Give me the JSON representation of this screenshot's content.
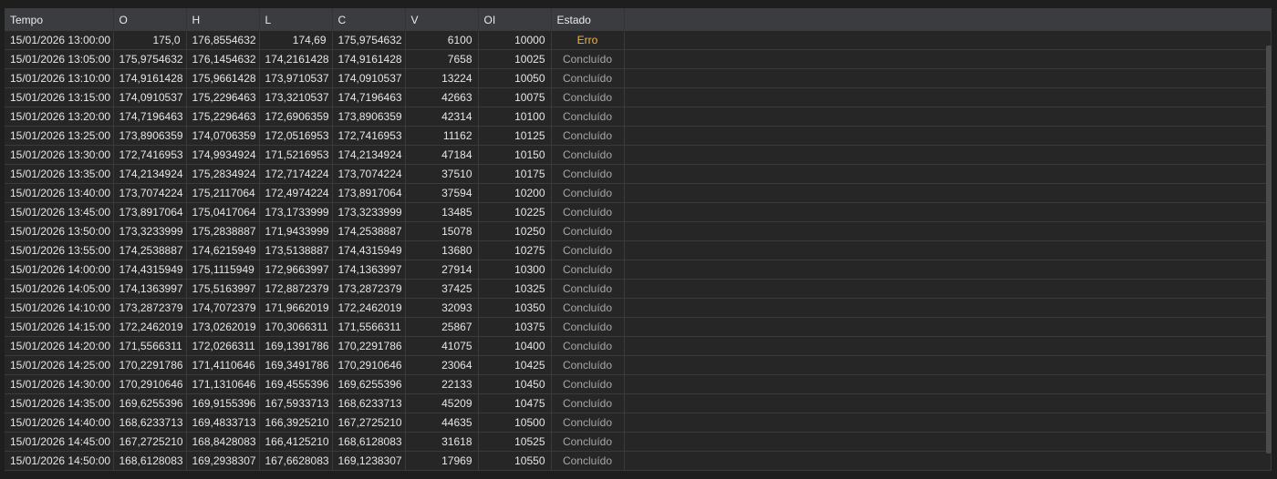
{
  "columns": [
    "Tempo",
    "O",
    "H",
    "L",
    "C",
    "V",
    "OI",
    "Estado"
  ],
  "colors": {
    "error": "#f3b53f",
    "status": "#a7a7a7"
  },
  "rows": [
    {
      "tempo": "15/01/2026 13:00:00",
      "o": "175,0",
      "h": "176,8554632",
      "l": "174,69",
      "c": "175,9754632",
      "v": "6100",
      "oi": "10000",
      "estado": "Erro"
    },
    {
      "tempo": "15/01/2026 13:05:00",
      "o": "175,9754632",
      "h": "176,1454632",
      "l": "174,2161428",
      "c": "174,9161428",
      "v": "7658",
      "oi": "10025",
      "estado": "Concluído"
    },
    {
      "tempo": "15/01/2026 13:10:00",
      "o": "174,9161428",
      "h": "175,9661428",
      "l": "173,9710537",
      "c": "174,0910537",
      "v": "13224",
      "oi": "10050",
      "estado": "Concluído"
    },
    {
      "tempo": "15/01/2026 13:15:00",
      "o": "174,0910537",
      "h": "175,2296463",
      "l": "173,3210537",
      "c": "174,7196463",
      "v": "42663",
      "oi": "10075",
      "estado": "Concluído"
    },
    {
      "tempo": "15/01/2026 13:20:00",
      "o": "174,7196463",
      "h": "175,2296463",
      "l": "172,6906359",
      "c": "173,8906359",
      "v": "42314",
      "oi": "10100",
      "estado": "Concluído"
    },
    {
      "tempo": "15/01/2026 13:25:00",
      "o": "173,8906359",
      "h": "174,0706359",
      "l": "172,0516953",
      "c": "172,7416953",
      "v": "11162",
      "oi": "10125",
      "estado": "Concluído"
    },
    {
      "tempo": "15/01/2026 13:30:00",
      "o": "172,7416953",
      "h": "174,9934924",
      "l": "171,5216953",
      "c": "174,2134924",
      "v": "47184",
      "oi": "10150",
      "estado": "Concluído"
    },
    {
      "tempo": "15/01/2026 13:35:00",
      "o": "174,2134924",
      "h": "175,2834924",
      "l": "172,7174224",
      "c": "173,7074224",
      "v": "37510",
      "oi": "10175",
      "estado": "Concluído"
    },
    {
      "tempo": "15/01/2026 13:40:00",
      "o": "173,7074224",
      "h": "175,2117064",
      "l": "172,4974224",
      "c": "173,8917064",
      "v": "37594",
      "oi": "10200",
      "estado": "Concluído"
    },
    {
      "tempo": "15/01/2026 13:45:00",
      "o": "173,8917064",
      "h": "175,0417064",
      "l": "173,1733999",
      "c": "173,3233999",
      "v": "13485",
      "oi": "10225",
      "estado": "Concluído"
    },
    {
      "tempo": "15/01/2026 13:50:00",
      "o": "173,3233999",
      "h": "175,2838887",
      "l": "171,9433999",
      "c": "174,2538887",
      "v": "15078",
      "oi": "10250",
      "estado": "Concluído"
    },
    {
      "tempo": "15/01/2026 13:55:00",
      "o": "174,2538887",
      "h": "174,6215949",
      "l": "173,5138887",
      "c": "174,4315949",
      "v": "13680",
      "oi": "10275",
      "estado": "Concluído"
    },
    {
      "tempo": "15/01/2026 14:00:00",
      "o": "174,4315949",
      "h": "175,1115949",
      "l": "172,9663997",
      "c": "174,1363997",
      "v": "27914",
      "oi": "10300",
      "estado": "Concluído"
    },
    {
      "tempo": "15/01/2026 14:05:00",
      "o": "174,1363997",
      "h": "175,5163997",
      "l": "172,8872379",
      "c": "173,2872379",
      "v": "37425",
      "oi": "10325",
      "estado": "Concluído"
    },
    {
      "tempo": "15/01/2026 14:10:00",
      "o": "173,2872379",
      "h": "174,7072379",
      "l": "171,9662019",
      "c": "172,2462019",
      "v": "32093",
      "oi": "10350",
      "estado": "Concluído"
    },
    {
      "tempo": "15/01/2026 14:15:00",
      "o": "172,2462019",
      "h": "173,0262019",
      "l": "170,3066311",
      "c": "171,5566311",
      "v": "25867",
      "oi": "10375",
      "estado": "Concluído"
    },
    {
      "tempo": "15/01/2026 14:20:00",
      "o": "171,5566311",
      "h": "172,0266311",
      "l": "169,1391786",
      "c": "170,2291786",
      "v": "41075",
      "oi": "10400",
      "estado": "Concluído"
    },
    {
      "tempo": "15/01/2026 14:25:00",
      "o": "170,2291786",
      "h": "171,4110646",
      "l": "169,3491786",
      "c": "170,2910646",
      "v": "23064",
      "oi": "10425",
      "estado": "Concluído"
    },
    {
      "tempo": "15/01/2026 14:30:00",
      "o": "170,2910646",
      "h": "171,1310646",
      "l": "169,4555396",
      "c": "169,6255396",
      "v": "22133",
      "oi": "10450",
      "estado": "Concluído"
    },
    {
      "tempo": "15/01/2026 14:35:00",
      "o": "169,6255396",
      "h": "169,9155396",
      "l": "167,5933713",
      "c": "168,6233713",
      "v": "45209",
      "oi": "10475",
      "estado": "Concluído"
    },
    {
      "tempo": "15/01/2026 14:40:00",
      "o": "168,6233713",
      "h": "169,4833713",
      "l": "166,3925210",
      "c": "167,2725210",
      "v": "44635",
      "oi": "10500",
      "estado": "Concluído"
    },
    {
      "tempo": "15/01/2026 14:45:00",
      "o": "167,2725210",
      "h": "168,8428083",
      "l": "166,4125210",
      "c": "168,6128083",
      "v": "31618",
      "oi": "10525",
      "estado": "Concluído"
    },
    {
      "tempo": "15/01/2026 14:50:00",
      "o": "168,6128083",
      "h": "169,2938307",
      "l": "167,6628083",
      "c": "169,1238307",
      "v": "17969",
      "oi": "10550",
      "estado": "Concluído"
    }
  ]
}
